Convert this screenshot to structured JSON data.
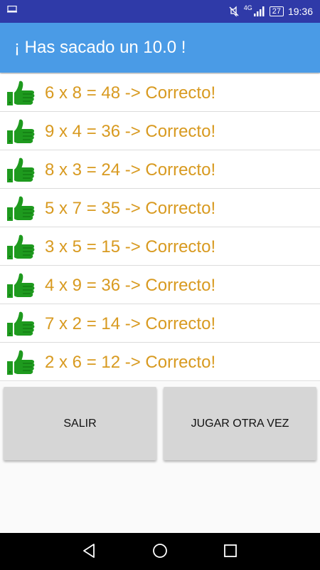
{
  "status_bar": {
    "time": "19:36",
    "battery": "27",
    "network": "4G",
    "icons": [
      "screen-icon",
      "mute-icon",
      "signal-icon",
      "battery-icon"
    ]
  },
  "app_bar": {
    "title": "¡ Has sacado un 10.0 !"
  },
  "results": [
    {
      "text": "6 x 8 = 48 -> Correcto!",
      "icon": "thumbs-up-icon"
    },
    {
      "text": "9 x 4 = 36 -> Correcto!",
      "icon": "thumbs-up-icon"
    },
    {
      "text": "8 x 3 = 24 -> Correcto!",
      "icon": "thumbs-up-icon"
    },
    {
      "text": "5 x 7 = 35 -> Correcto!",
      "icon": "thumbs-up-icon"
    },
    {
      "text": "3 x 5 = 15 -> Correcto!",
      "icon": "thumbs-up-icon"
    },
    {
      "text": "4 x 9 = 36 -> Correcto!",
      "icon": "thumbs-up-icon"
    },
    {
      "text": "7 x 2 = 14 -> Correcto!",
      "icon": "thumbs-up-icon"
    },
    {
      "text": "2 x 6 = 12 -> Correcto!",
      "icon": "thumbs-up-icon"
    }
  ],
  "buttons": {
    "exit_label": "SALIR",
    "replay_label": "JUGAR OTRA VEZ"
  },
  "colors": {
    "status_bar": "#2f3aa8",
    "app_bar": "#4a9be6",
    "result_text": "#d89a20",
    "thumb": "#1e9a1e",
    "button_bg": "#d6d6d6"
  }
}
